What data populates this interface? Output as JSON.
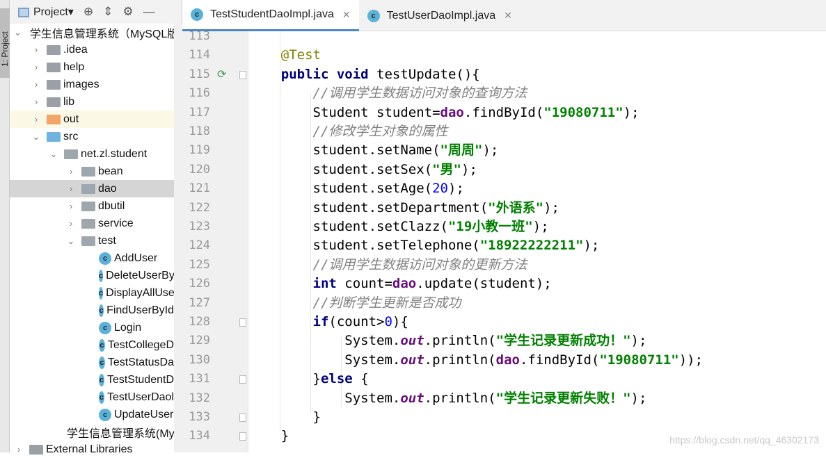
{
  "toolstrip": {
    "project_tab": "1: Project"
  },
  "panel": {
    "title": "Project",
    "icons": [
      "locate-icon",
      "collapse-icon",
      "gear-icon",
      "minimize-icon"
    ]
  },
  "tree": [
    {
      "label": "学生信息管理系统（MySQL版",
      "depth": 0,
      "arrow": "down",
      "icon": "module"
    },
    {
      "label": ".idea",
      "depth": 1,
      "arrow": "right",
      "icon": "folder"
    },
    {
      "label": "help",
      "depth": 1,
      "arrow": "right",
      "icon": "folder"
    },
    {
      "label": "images",
      "depth": 1,
      "arrow": "right",
      "icon": "folder"
    },
    {
      "label": "lib",
      "depth": 1,
      "arrow": "right",
      "icon": "folder"
    },
    {
      "label": "out",
      "depth": 1,
      "arrow": "right",
      "icon": "folder-orange",
      "highlight": true
    },
    {
      "label": "src",
      "depth": 1,
      "arrow": "down",
      "icon": "folder-blue"
    },
    {
      "label": "net.zl.student",
      "depth": 2,
      "arrow": "down",
      "icon": "package"
    },
    {
      "label": "bean",
      "depth": 3,
      "arrow": "right",
      "icon": "package"
    },
    {
      "label": "dao",
      "depth": 3,
      "arrow": "right",
      "icon": "package",
      "selected": true
    },
    {
      "label": "dbutil",
      "depth": 3,
      "arrow": "right",
      "icon": "package"
    },
    {
      "label": "service",
      "depth": 3,
      "arrow": "right",
      "icon": "package"
    },
    {
      "label": "test",
      "depth": 3,
      "arrow": "down",
      "icon": "package"
    },
    {
      "label": "AddUser",
      "depth": 4,
      "icon": "class"
    },
    {
      "label": "DeleteUserBy",
      "depth": 4,
      "icon": "class"
    },
    {
      "label": "DisplayAllUse",
      "depth": 4,
      "icon": "class"
    },
    {
      "label": "FindUserById",
      "depth": 4,
      "icon": "class"
    },
    {
      "label": "Login",
      "depth": 4,
      "icon": "class"
    },
    {
      "label": "TestCollegeD",
      "depth": 4,
      "icon": "class"
    },
    {
      "label": "TestStatusDa",
      "depth": 4,
      "icon": "class"
    },
    {
      "label": "TestStudentD",
      "depth": 4,
      "icon": "class"
    },
    {
      "label": "TestUserDaol",
      "depth": 4,
      "icon": "class"
    },
    {
      "label": "UpdateUser",
      "depth": 4,
      "icon": "class"
    },
    {
      "label": "学生信息管理系统(MySQL",
      "depth": 2,
      "icon": "file"
    },
    {
      "label": "External Libraries",
      "depth": 0,
      "arrow": "right",
      "icon": "library"
    }
  ],
  "tabs": [
    {
      "label": "TestStudentDaoImpl.java",
      "active": true
    },
    {
      "label": "TestUserDaoImpl.java",
      "active": false
    }
  ],
  "code": [
    {
      "n": "113",
      "t": []
    },
    {
      "n": "114",
      "t": [
        [
          "    @Test",
          "an"
        ]
      ]
    },
    {
      "n": "115",
      "run": true,
      "fold": true,
      "t": [
        [
          "    public void ",
          "kw"
        ],
        [
          "testUpdate(){",
          ""
        ]
      ]
    },
    {
      "n": "116",
      "t": [
        [
          "        //调用学生数据访问对象的查询方法",
          "cm"
        ]
      ]
    },
    {
      "n": "117",
      "t": [
        [
          "        Student student=",
          ""
        ],
        [
          "dao",
          "fd"
        ],
        [
          ".findById(",
          ""
        ],
        [
          "\"19080711\"",
          "st"
        ],
        [
          ");",
          ""
        ]
      ]
    },
    {
      "n": "118",
      "t": [
        [
          "        //修改学生对象的属性",
          "cm"
        ]
      ]
    },
    {
      "n": "119",
      "t": [
        [
          "        student.setName(",
          ""
        ],
        [
          "\"周周\"",
          "st"
        ],
        [
          ");",
          ""
        ]
      ]
    },
    {
      "n": "120",
      "t": [
        [
          "        student.setSex(",
          ""
        ],
        [
          "\"男\"",
          "st"
        ],
        [
          ");",
          ""
        ]
      ]
    },
    {
      "n": "121",
      "t": [
        [
          "        student.setAge(",
          ""
        ],
        [
          "20",
          "nm"
        ],
        [
          ");",
          ""
        ]
      ]
    },
    {
      "n": "122",
      "t": [
        [
          "        student.setDepartment(",
          ""
        ],
        [
          "\"外语系\"",
          "st"
        ],
        [
          ");",
          ""
        ]
      ]
    },
    {
      "n": "123",
      "t": [
        [
          "        student.setClazz(",
          ""
        ],
        [
          "\"19小教一班\"",
          "st"
        ],
        [
          ");",
          ""
        ]
      ]
    },
    {
      "n": "124",
      "t": [
        [
          "        student.setTelephone(",
          ""
        ],
        [
          "\"18922222211\"",
          "st"
        ],
        [
          ");",
          ""
        ]
      ]
    },
    {
      "n": "125",
      "t": [
        [
          "        //调用学生数据访问对象的更新方法",
          "cm"
        ]
      ]
    },
    {
      "n": "126",
      "t": [
        [
          "        int ",
          "kw"
        ],
        [
          "count=",
          ""
        ],
        [
          "dao",
          "fd"
        ],
        [
          ".update(student);",
          ""
        ]
      ]
    },
    {
      "n": "127",
      "t": [
        [
          "        //判断学生更新是否成功",
          "cm"
        ]
      ]
    },
    {
      "n": "128",
      "fold": true,
      "t": [
        [
          "        if",
          "kw"
        ],
        [
          "(count>",
          ""
        ],
        [
          "0",
          "nm"
        ],
        [
          "){",
          ""
        ]
      ]
    },
    {
      "n": "129",
      "t": [
        [
          "            System.",
          ""
        ],
        [
          "out",
          "sf"
        ],
        [
          ".println(",
          ""
        ],
        [
          "\"学生记录更新成功！\"",
          "st"
        ],
        [
          ");",
          ""
        ]
      ]
    },
    {
      "n": "130",
      "t": [
        [
          "            System.",
          ""
        ],
        [
          "out",
          "sf"
        ],
        [
          ".println(",
          ""
        ],
        [
          "dao",
          "fd"
        ],
        [
          ".findById(",
          ""
        ],
        [
          "\"19080711\"",
          "st"
        ],
        [
          "));",
          ""
        ]
      ]
    },
    {
      "n": "131",
      "fold": true,
      "t": [
        [
          "        }",
          ""
        ],
        [
          "else ",
          "kw"
        ],
        [
          "{",
          ""
        ]
      ]
    },
    {
      "n": "132",
      "t": [
        [
          "            System.",
          ""
        ],
        [
          "out",
          "sf"
        ],
        [
          ".println(",
          ""
        ],
        [
          "\"学生记录更新失败！\"",
          "st"
        ],
        [
          ");",
          ""
        ]
      ]
    },
    {
      "n": "133",
      "fold": true,
      "t": [
        [
          "        }",
          ""
        ]
      ]
    },
    {
      "n": "134",
      "fold": true,
      "t": [
        [
          "    }",
          ""
        ]
      ]
    }
  ],
  "watermark": "https://blog.csdn.net/qq_46302173"
}
